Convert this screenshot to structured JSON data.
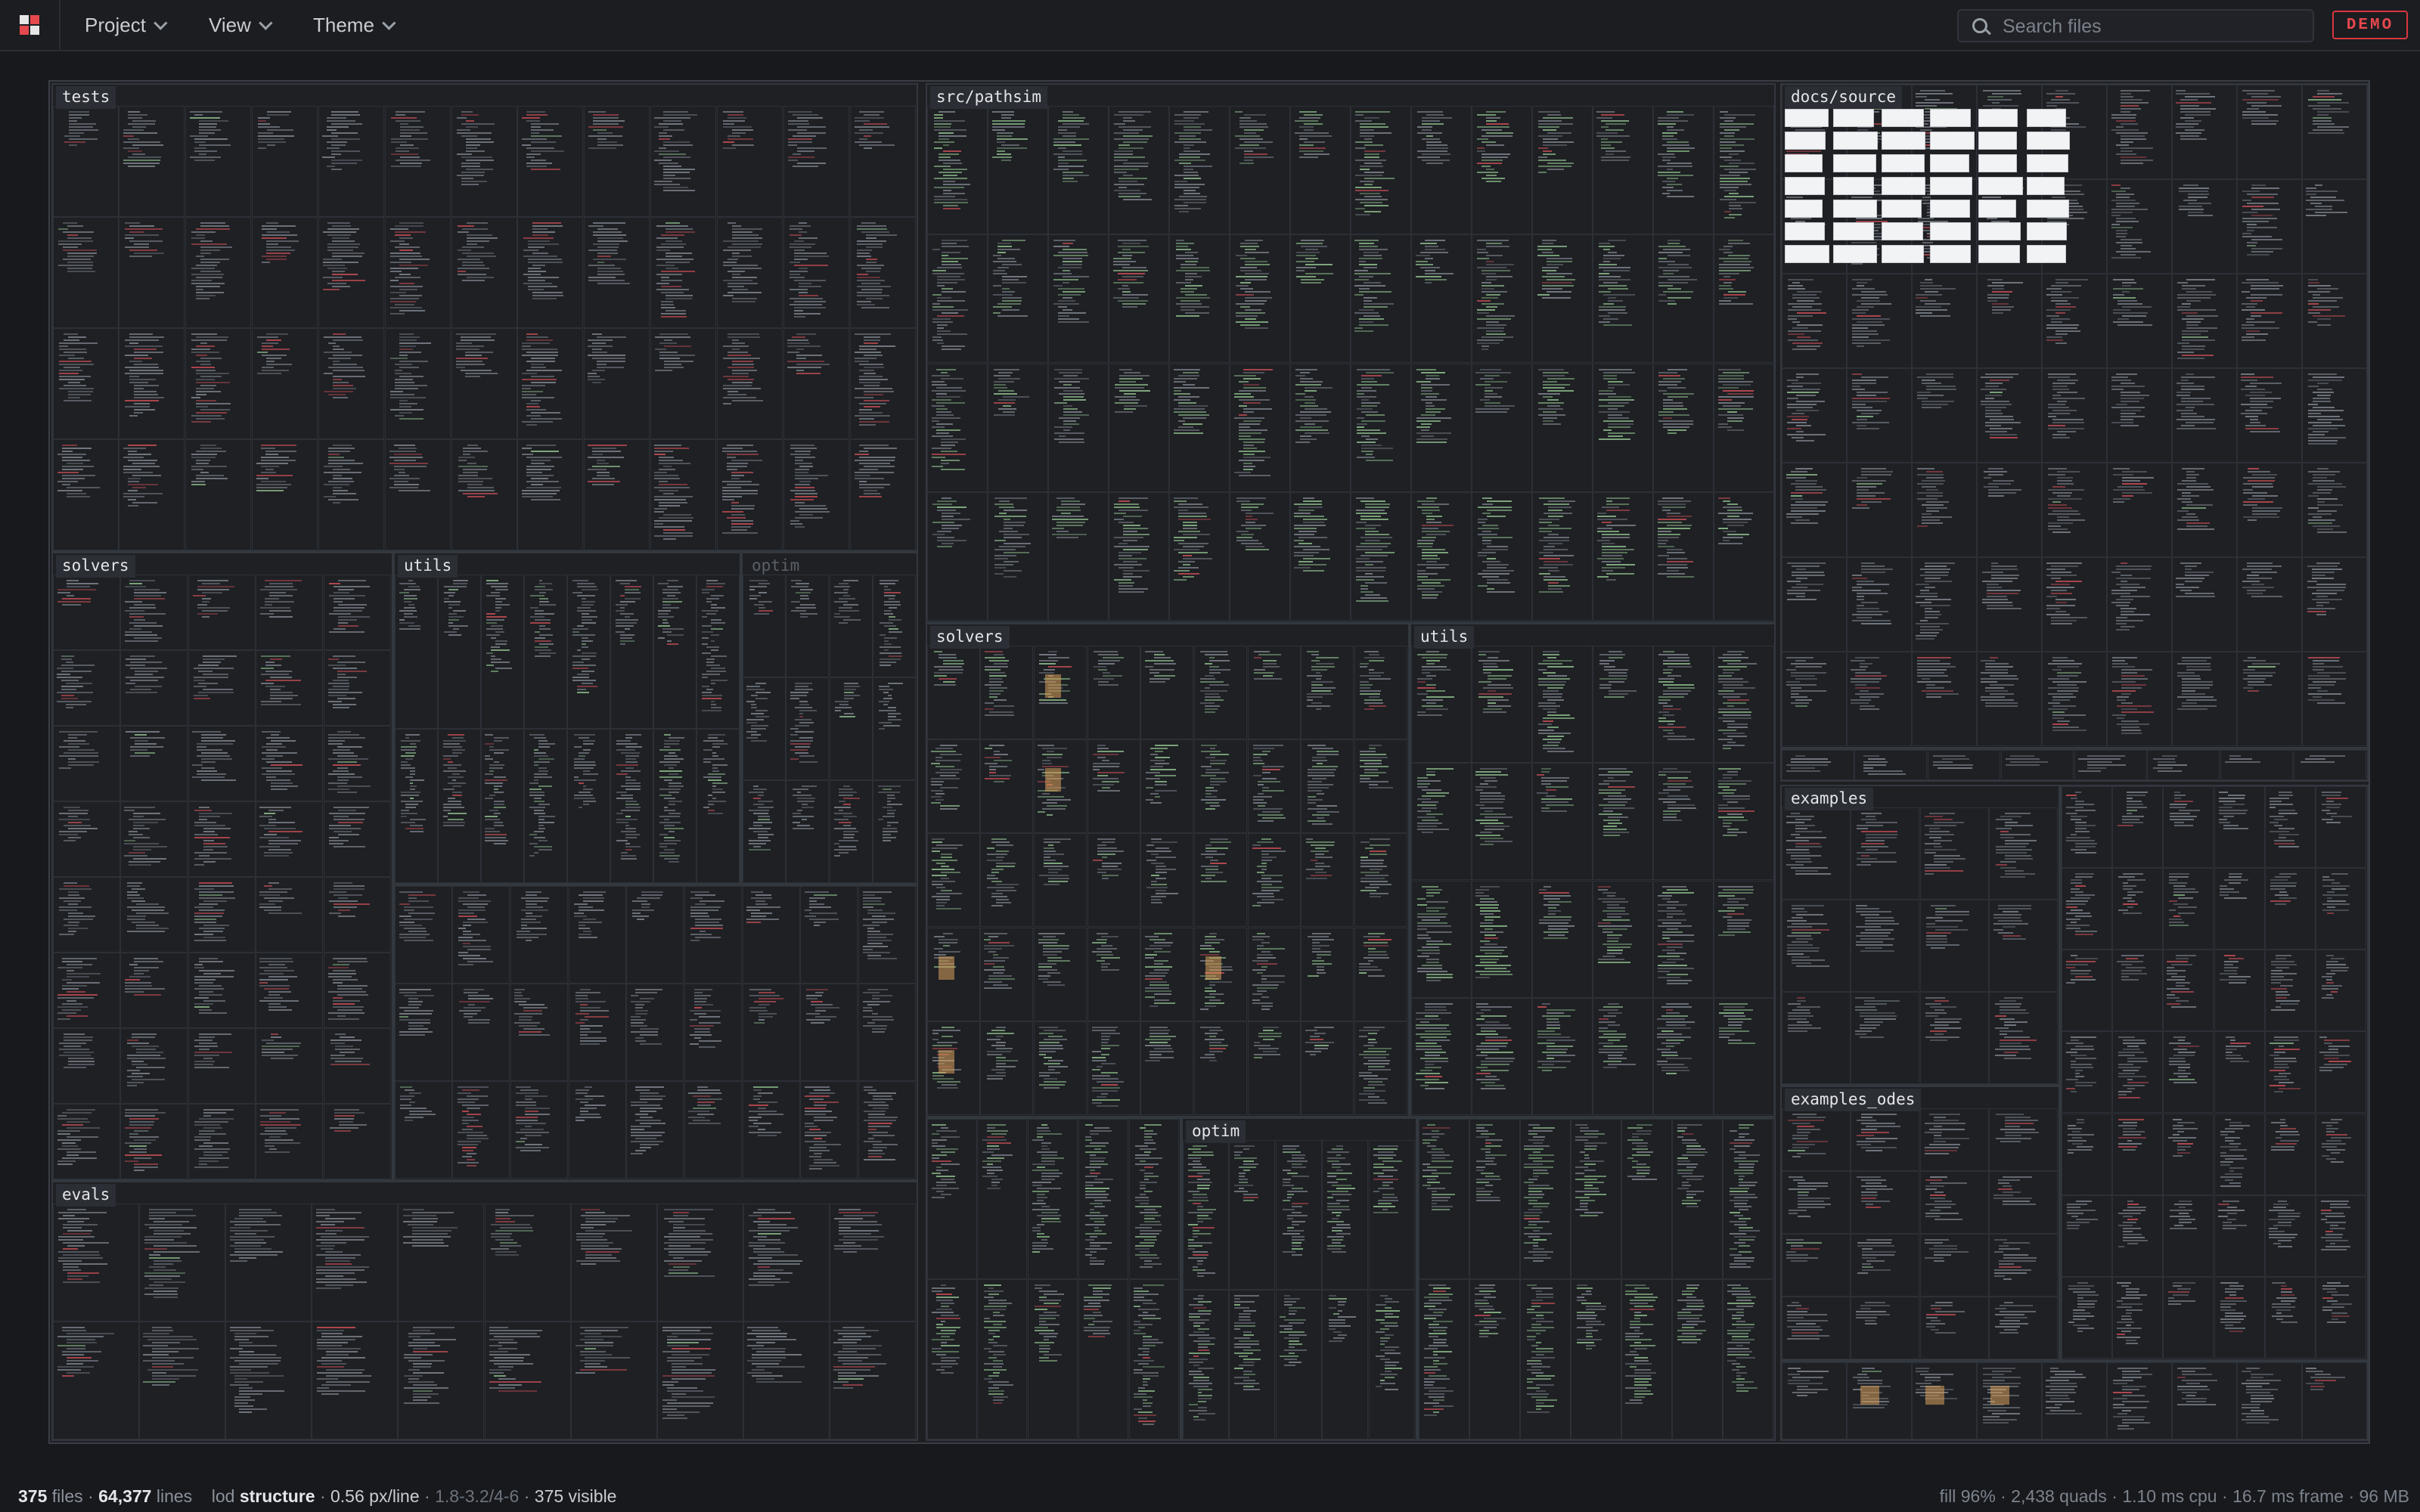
{
  "menu": {
    "project": "Project",
    "view": "View",
    "theme": "Theme"
  },
  "search": {
    "placeholder": "Search files"
  },
  "badge": {
    "demo": "DEMO"
  },
  "colors": {
    "accent_red": "#e5484d",
    "code_green": "#9fd49a",
    "code_gray": "#8d939c",
    "code_red": "#e0555c",
    "highlight_orange": "#d9a05b",
    "background": "#17191d"
  },
  "icons": {
    "logo": "app-logo-icon",
    "search": "search-icon",
    "chevron": "chevron-down-icon"
  },
  "treemap": {
    "labels": {
      "tests": "tests",
      "tests_solvers": "solvers",
      "tests_utils": "utils",
      "tests_optim": "optim",
      "tests_evals": "evals",
      "src": "src/pathsim",
      "src_solvers": "solvers",
      "src_utils": "utils",
      "src_optim": "optim",
      "docs": "docs/source",
      "examples": "examples",
      "examples_odes": "examples_odes"
    }
  },
  "status": {
    "files_count": "375",
    "files_label": "files",
    "lines_count": "64,377",
    "lines_label": "lines",
    "lod_label": "lod",
    "lod_value": "structure",
    "density": "0.56 px/line",
    "range": "1.8-3.2/4-6",
    "visible": "375 visible",
    "fill": "fill 96%",
    "quads": "2,438 quads",
    "cpu": "1.10 ms cpu",
    "frame": "16.7 ms frame",
    "memory": "96 MB",
    "sep": "·"
  }
}
